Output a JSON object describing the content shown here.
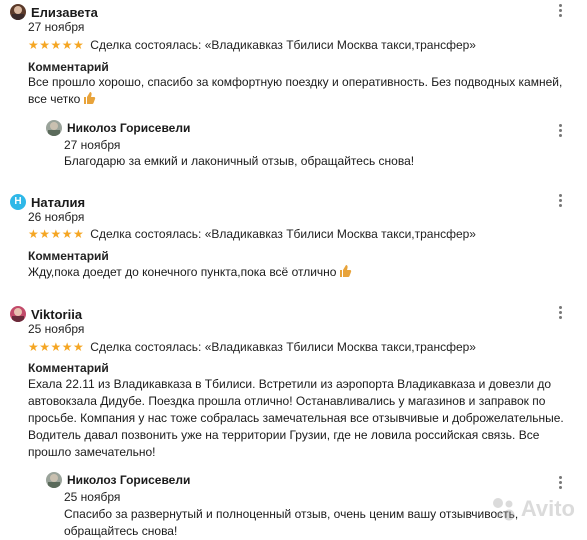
{
  "reviews": [
    {
      "author": "Елизавета",
      "date": "27 ноября",
      "stars": "★★★★★",
      "deal": "Сделка состоялась: «Владикавказ Тбилиси Москва такси,трансфер»",
      "comment_label": "Комментарий",
      "comment": "Все прошло хорошо, спасибо за комфортную поездку и оперативность. Без подводных камней, все четко",
      "reply": {
        "author": "Николоз Горисевели",
        "date": "27 ноября",
        "text": "Благодарю за емкий и лаконичный отзыв, обращайтесь снова!"
      }
    },
    {
      "author": "Наталия",
      "avatar_letter": "Н",
      "date": "26 ноября",
      "stars": "★★★★★",
      "deal": "Сделка состоялась: «Владикавказ Тбилиси Москва такси,трансфер»",
      "comment_label": "Комментарий",
      "comment": "Жду,пока доедет до конечного пункта,пока всё отлично"
    },
    {
      "author": "Viktoriia",
      "date": "25 ноября",
      "stars": "★★★★★",
      "deal": "Сделка состоялась: «Владикавказ Тбилиси Москва такси,трансфер»",
      "comment_label": "Комментарий",
      "comment": "Ехала 22.11 из Владикавказа в Тбилиси. Встретили из аэропорта Владикавказа и довезли до автовокзала Дидубе. Поездка прошла отлично! Останавливались у магазинов и заправок по просьбе. Компания у нас тоже собралась замечательная все отзывчивые и доброжелательные. Водитель давал позвонить уже на территории Грузии, где не ловила российская связь. Все прошло замечательно!",
      "reply": {
        "author": "Николоз Горисевели",
        "date": "25 ноября",
        "text": "Спасибо за развернутый и полноценный отзыв, очень ценим вашу отзывчивость, обращайтесь снова!"
      }
    }
  ],
  "watermark": "Avito",
  "colors": {
    "star": "#f5a623",
    "avatar_natalia": "#2fb8e8"
  }
}
